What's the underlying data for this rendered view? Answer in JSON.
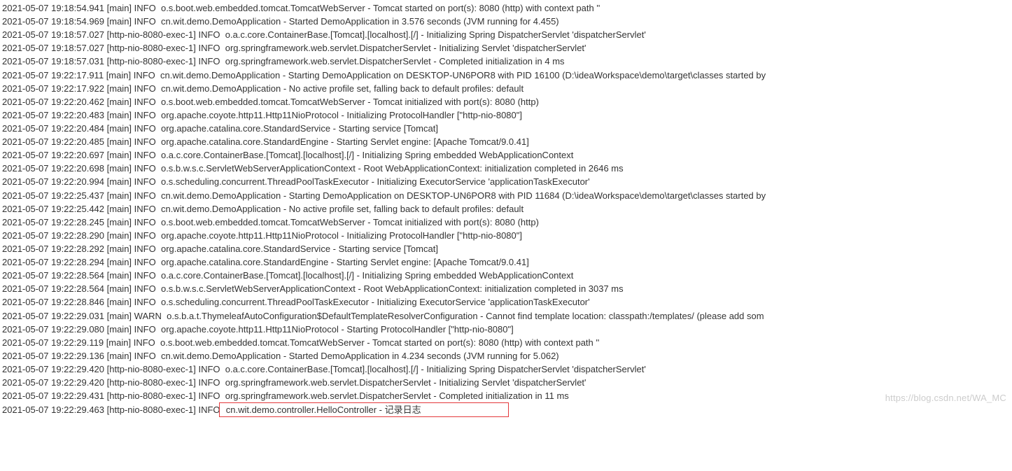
{
  "watermark": "https://blog.csdn.net/WA_MC",
  "log_lines": [
    {
      "ts": "2021-05-07 19:18:54.941",
      "thread": "[main]",
      "level": "INFO",
      "rest": "  o.s.boot.web.embedded.tomcat.TomcatWebServer - Tomcat started on port(s): 8080 (http) with context path ''"
    },
    {
      "ts": "2021-05-07 19:18:54.969",
      "thread": "[main]",
      "level": "INFO",
      "rest": "  cn.wit.demo.DemoApplication - Started DemoApplication in 3.576 seconds (JVM running for 4.455)"
    },
    {
      "ts": "2021-05-07 19:18:57.027",
      "thread": "[http-nio-8080-exec-1]",
      "level": "INFO",
      "rest": "  o.a.c.core.ContainerBase.[Tomcat].[localhost].[/] - Initializing Spring DispatcherServlet 'dispatcherServlet'"
    },
    {
      "ts": "2021-05-07 19:18:57.027",
      "thread": "[http-nio-8080-exec-1]",
      "level": "INFO",
      "rest": "  org.springframework.web.servlet.DispatcherServlet - Initializing Servlet 'dispatcherServlet'"
    },
    {
      "ts": "2021-05-07 19:18:57.031",
      "thread": "[http-nio-8080-exec-1]",
      "level": "INFO",
      "rest": "  org.springframework.web.servlet.DispatcherServlet - Completed initialization in 4 ms"
    },
    {
      "ts": "2021-05-07 19:22:17.911",
      "thread": "[main]",
      "level": "INFO",
      "rest": "  cn.wit.demo.DemoApplication - Starting DemoApplication on DESKTOP-UN6POR8 with PID 16100 (D:\\ideaWorkspace\\demo\\target\\classes started by "
    },
    {
      "ts": "2021-05-07 19:22:17.922",
      "thread": "[main]",
      "level": "INFO",
      "rest": "  cn.wit.demo.DemoApplication - No active profile set, falling back to default profiles: default"
    },
    {
      "ts": "2021-05-07 19:22:20.462",
      "thread": "[main]",
      "level": "INFO",
      "rest": "  o.s.boot.web.embedded.tomcat.TomcatWebServer - Tomcat initialized with port(s): 8080 (http)"
    },
    {
      "ts": "2021-05-07 19:22:20.483",
      "thread": "[main]",
      "level": "INFO",
      "rest": "  org.apache.coyote.http11.Http11NioProtocol - Initializing ProtocolHandler [\"http-nio-8080\"]"
    },
    {
      "ts": "2021-05-07 19:22:20.484",
      "thread": "[main]",
      "level": "INFO",
      "rest": "  org.apache.catalina.core.StandardService - Starting service [Tomcat]"
    },
    {
      "ts": "2021-05-07 19:22:20.485",
      "thread": "[main]",
      "level": "INFO",
      "rest": "  org.apache.catalina.core.StandardEngine - Starting Servlet engine: [Apache Tomcat/9.0.41]"
    },
    {
      "ts": "2021-05-07 19:22:20.697",
      "thread": "[main]",
      "level": "INFO",
      "rest": "  o.a.c.core.ContainerBase.[Tomcat].[localhost].[/] - Initializing Spring embedded WebApplicationContext"
    },
    {
      "ts": "2021-05-07 19:22:20.698",
      "thread": "[main]",
      "level": "INFO",
      "rest": "  o.s.b.w.s.c.ServletWebServerApplicationContext - Root WebApplicationContext: initialization completed in 2646 ms"
    },
    {
      "ts": "2021-05-07 19:22:20.994",
      "thread": "[main]",
      "level": "INFO",
      "rest": "  o.s.scheduling.concurrent.ThreadPoolTaskExecutor - Initializing ExecutorService 'applicationTaskExecutor'"
    },
    {
      "ts": "2021-05-07 19:22:25.437",
      "thread": "[main]",
      "level": "INFO",
      "rest": "  cn.wit.demo.DemoApplication - Starting DemoApplication on DESKTOP-UN6POR8 with PID 11684 (D:\\ideaWorkspace\\demo\\target\\classes started by "
    },
    {
      "ts": "2021-05-07 19:22:25.442",
      "thread": "[main]",
      "level": "INFO",
      "rest": "  cn.wit.demo.DemoApplication - No active profile set, falling back to default profiles: default"
    },
    {
      "ts": "2021-05-07 19:22:28.245",
      "thread": "[main]",
      "level": "INFO",
      "rest": "  o.s.boot.web.embedded.tomcat.TomcatWebServer - Tomcat initialized with port(s): 8080 (http)"
    },
    {
      "ts": "2021-05-07 19:22:28.290",
      "thread": "[main]",
      "level": "INFO",
      "rest": "  org.apache.coyote.http11.Http11NioProtocol - Initializing ProtocolHandler [\"http-nio-8080\"]"
    },
    {
      "ts": "2021-05-07 19:22:28.292",
      "thread": "[main]",
      "level": "INFO",
      "rest": "  org.apache.catalina.core.StandardService - Starting service [Tomcat]"
    },
    {
      "ts": "2021-05-07 19:22:28.294",
      "thread": "[main]",
      "level": "INFO",
      "rest": "  org.apache.catalina.core.StandardEngine - Starting Servlet engine: [Apache Tomcat/9.0.41]"
    },
    {
      "ts": "2021-05-07 19:22:28.564",
      "thread": "[main]",
      "level": "INFO",
      "rest": "  o.a.c.core.ContainerBase.[Tomcat].[localhost].[/] - Initializing Spring embedded WebApplicationContext"
    },
    {
      "ts": "2021-05-07 19:22:28.564",
      "thread": "[main]",
      "level": "INFO",
      "rest": "  o.s.b.w.s.c.ServletWebServerApplicationContext - Root WebApplicationContext: initialization completed in 3037 ms"
    },
    {
      "ts": "2021-05-07 19:22:28.846",
      "thread": "[main]",
      "level": "INFO",
      "rest": "  o.s.scheduling.concurrent.ThreadPoolTaskExecutor - Initializing ExecutorService 'applicationTaskExecutor'"
    },
    {
      "ts": "2021-05-07 19:22:29.031",
      "thread": "[main]",
      "level": "WARN",
      "rest": "  o.s.b.a.t.ThymeleafAutoConfiguration$DefaultTemplateResolverConfiguration - Cannot find template location: classpath:/templates/ (please add som"
    },
    {
      "ts": "2021-05-07 19:22:29.080",
      "thread": "[main]",
      "level": "INFO",
      "rest": "  org.apache.coyote.http11.Http11NioProtocol - Starting ProtocolHandler [\"http-nio-8080\"]"
    },
    {
      "ts": "2021-05-07 19:22:29.119",
      "thread": "[main]",
      "level": "INFO",
      "rest": "  o.s.boot.web.embedded.tomcat.TomcatWebServer - Tomcat started on port(s): 8080 (http) with context path ''"
    },
    {
      "ts": "2021-05-07 19:22:29.136",
      "thread": "[main]",
      "level": "INFO",
      "rest": "  cn.wit.demo.DemoApplication - Started DemoApplication in 4.234 seconds (JVM running for 5.062)"
    },
    {
      "ts": "2021-05-07 19:22:29.420",
      "thread": "[http-nio-8080-exec-1]",
      "level": "INFO",
      "rest": "  o.a.c.core.ContainerBase.[Tomcat].[localhost].[/] - Initializing Spring DispatcherServlet 'dispatcherServlet'"
    },
    {
      "ts": "2021-05-07 19:22:29.420",
      "thread": "[http-nio-8080-exec-1]",
      "level": "INFO",
      "rest": "  org.springframework.web.servlet.DispatcherServlet - Initializing Servlet 'dispatcherServlet'"
    },
    {
      "ts": "2021-05-07 19:22:29.431",
      "thread": "[http-nio-8080-exec-1]",
      "level": "INFO",
      "rest": "  org.springframework.web.servlet.DispatcherServlet - Completed initialization in 11 ms"
    },
    {
      "ts": "2021-05-07 19:22:29.463",
      "thread": "[http-nio-8080-exec-1]",
      "level": "INFO",
      "rest": "",
      "highlighted": "  cn.wit.demo.controller.HelloController - 记录日志",
      "boxed": true
    }
  ]
}
